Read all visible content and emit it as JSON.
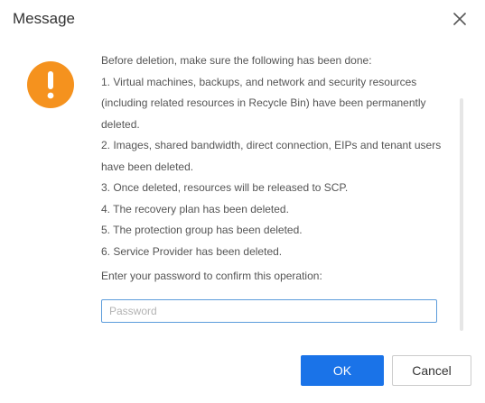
{
  "dialog": {
    "title": "Message",
    "close_icon": "close-icon",
    "warning_icon": "exclamation-warning-icon",
    "warning_color": "#f5921e",
    "intro": "Before deletion, make sure the following has been done:",
    "items": [
      "1. Virtual machines, backups, and network and security resources (including related resources in Recycle Bin) have been permanently deleted.",
      "2. Images, shared bandwidth, direct connection, EIPs and tenant users have been deleted.",
      "3. Once deleted, resources will be released to SCP.",
      "4. The recovery plan has been deleted.",
      "5. The protection group has been deleted.",
      "6. Service Provider has been deleted."
    ],
    "prompt": "Enter your password to confirm this operation:",
    "password": {
      "value": "",
      "placeholder": "Password"
    },
    "ok_label": "OK",
    "cancel_label": "Cancel",
    "primary_color": "#1a73e8"
  }
}
